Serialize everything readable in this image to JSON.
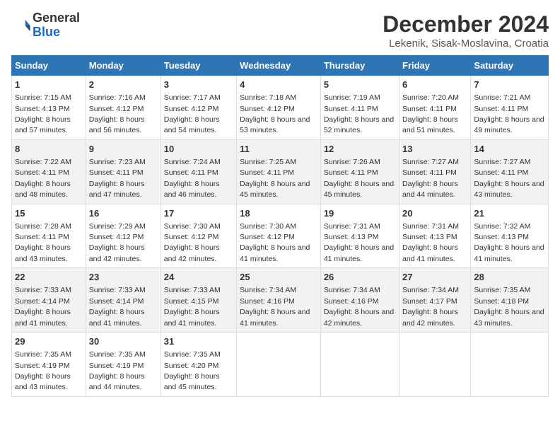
{
  "header": {
    "logo_line1": "General",
    "logo_line2": "Blue",
    "title": "December 2024",
    "subtitle": "Lekenik, Sisak-Moslavina, Croatia"
  },
  "days_of_week": [
    "Sunday",
    "Monday",
    "Tuesday",
    "Wednesday",
    "Thursday",
    "Friday",
    "Saturday"
  ],
  "weeks": [
    [
      {
        "day": "1",
        "sunrise": "7:15 AM",
        "sunset": "4:13 PM",
        "daylight": "8 hours and 57 minutes."
      },
      {
        "day": "2",
        "sunrise": "7:16 AM",
        "sunset": "4:12 PM",
        "daylight": "8 hours and 56 minutes."
      },
      {
        "day": "3",
        "sunrise": "7:17 AM",
        "sunset": "4:12 PM",
        "daylight": "8 hours and 54 minutes."
      },
      {
        "day": "4",
        "sunrise": "7:18 AM",
        "sunset": "4:12 PM",
        "daylight": "8 hours and 53 minutes."
      },
      {
        "day": "5",
        "sunrise": "7:19 AM",
        "sunset": "4:11 PM",
        "daylight": "8 hours and 52 minutes."
      },
      {
        "day": "6",
        "sunrise": "7:20 AM",
        "sunset": "4:11 PM",
        "daylight": "8 hours and 51 minutes."
      },
      {
        "day": "7",
        "sunrise": "7:21 AM",
        "sunset": "4:11 PM",
        "daylight": "8 hours and 49 minutes."
      }
    ],
    [
      {
        "day": "8",
        "sunrise": "7:22 AM",
        "sunset": "4:11 PM",
        "daylight": "8 hours and 48 minutes."
      },
      {
        "day": "9",
        "sunrise": "7:23 AM",
        "sunset": "4:11 PM",
        "daylight": "8 hours and 47 minutes."
      },
      {
        "day": "10",
        "sunrise": "7:24 AM",
        "sunset": "4:11 PM",
        "daylight": "8 hours and 46 minutes."
      },
      {
        "day": "11",
        "sunrise": "7:25 AM",
        "sunset": "4:11 PM",
        "daylight": "8 hours and 45 minutes."
      },
      {
        "day": "12",
        "sunrise": "7:26 AM",
        "sunset": "4:11 PM",
        "daylight": "8 hours and 45 minutes."
      },
      {
        "day": "13",
        "sunrise": "7:27 AM",
        "sunset": "4:11 PM",
        "daylight": "8 hours and 44 minutes."
      },
      {
        "day": "14",
        "sunrise": "7:27 AM",
        "sunset": "4:11 PM",
        "daylight": "8 hours and 43 minutes."
      }
    ],
    [
      {
        "day": "15",
        "sunrise": "7:28 AM",
        "sunset": "4:11 PM",
        "daylight": "8 hours and 43 minutes."
      },
      {
        "day": "16",
        "sunrise": "7:29 AM",
        "sunset": "4:12 PM",
        "daylight": "8 hours and 42 minutes."
      },
      {
        "day": "17",
        "sunrise": "7:30 AM",
        "sunset": "4:12 PM",
        "daylight": "8 hours and 42 minutes."
      },
      {
        "day": "18",
        "sunrise": "7:30 AM",
        "sunset": "4:12 PM",
        "daylight": "8 hours and 41 minutes."
      },
      {
        "day": "19",
        "sunrise": "7:31 AM",
        "sunset": "4:13 PM",
        "daylight": "8 hours and 41 minutes."
      },
      {
        "day": "20",
        "sunrise": "7:31 AM",
        "sunset": "4:13 PM",
        "daylight": "8 hours and 41 minutes."
      },
      {
        "day": "21",
        "sunrise": "7:32 AM",
        "sunset": "4:13 PM",
        "daylight": "8 hours and 41 minutes."
      }
    ],
    [
      {
        "day": "22",
        "sunrise": "7:33 AM",
        "sunset": "4:14 PM",
        "daylight": "8 hours and 41 minutes."
      },
      {
        "day": "23",
        "sunrise": "7:33 AM",
        "sunset": "4:14 PM",
        "daylight": "8 hours and 41 minutes."
      },
      {
        "day": "24",
        "sunrise": "7:33 AM",
        "sunset": "4:15 PM",
        "daylight": "8 hours and 41 minutes."
      },
      {
        "day": "25",
        "sunrise": "7:34 AM",
        "sunset": "4:16 PM",
        "daylight": "8 hours and 41 minutes."
      },
      {
        "day": "26",
        "sunrise": "7:34 AM",
        "sunset": "4:16 PM",
        "daylight": "8 hours and 42 minutes."
      },
      {
        "day": "27",
        "sunrise": "7:34 AM",
        "sunset": "4:17 PM",
        "daylight": "8 hours and 42 minutes."
      },
      {
        "day": "28",
        "sunrise": "7:35 AM",
        "sunset": "4:18 PM",
        "daylight": "8 hours and 43 minutes."
      }
    ],
    [
      {
        "day": "29",
        "sunrise": "7:35 AM",
        "sunset": "4:19 PM",
        "daylight": "8 hours and 43 minutes."
      },
      {
        "day": "30",
        "sunrise": "7:35 AM",
        "sunset": "4:19 PM",
        "daylight": "8 hours and 44 minutes."
      },
      {
        "day": "31",
        "sunrise": "7:35 AM",
        "sunset": "4:20 PM",
        "daylight": "8 hours and 45 minutes."
      },
      null,
      null,
      null,
      null
    ]
  ]
}
